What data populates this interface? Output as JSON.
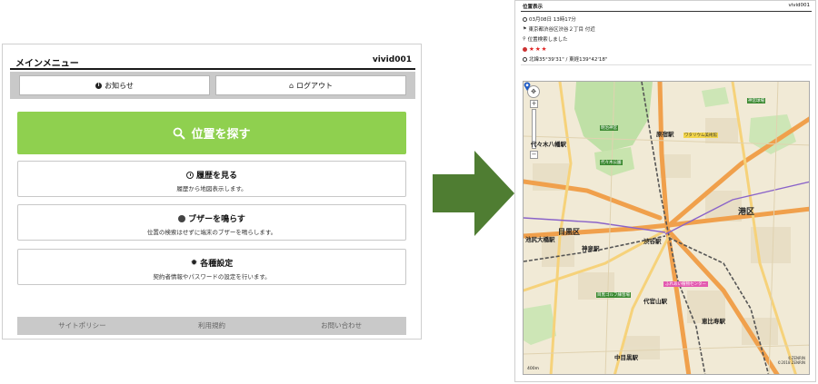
{
  "left": {
    "header": {
      "title": "メインメニュー",
      "user": "vivid001"
    },
    "nav": {
      "info_label": "お知らせ",
      "logout_label": "ログアウト"
    },
    "search_label": "位置を探す",
    "menu": [
      {
        "title": "履歴を見る",
        "desc": "履歴から地図表示します。"
      },
      {
        "title": "ブザーを鳴らす",
        "desc": "位置の検索はせずに端末のブザーを鳴らします。"
      },
      {
        "title": "各種設定",
        "desc": "契約者情報やパスワードの設定を行います。"
      }
    ],
    "footer": [
      "サイトポリシー",
      "利用規約",
      "お問い合わせ"
    ]
  },
  "right": {
    "header": {
      "title": "位置表示",
      "user": "vivid001"
    },
    "info": {
      "datetime": "03月08日 13時17分",
      "address": "東京都渋谷区渋谷２丁目 付近",
      "status": "位置検索しました",
      "accuracy_stars": "★★★",
      "coords": "北緯35°39'31\" / 東経139°42'18\""
    },
    "map": {
      "labels": {
        "yoyogi_hachiman": "代々木八幡駅",
        "harajuku": "原宿駅",
        "shibuya": "渋谷駅",
        "shinsen": "神泉駅",
        "daikanyama": "代官山駅",
        "ebisu": "恵比寿駅",
        "naka_meguro": "中目黒駅",
        "ikejiri": "池尻大橋駅",
        "meguro_ku": "目黒区",
        "minato_ku": "港区",
        "jingu": "明治神宮",
        "yoyogi_park": "代々木公園",
        "aoyama": "ワタリウム美術館",
        "kodomo": "ふれあい植物センター",
        "jingu_gaien": "神宮球場",
        "meguro_golf": "目黒ゴルフ練習場"
      },
      "scale": "400m",
      "copyright_1": "©ZENRIN",
      "copyright_2": "©2018 ZENRIN"
    }
  }
}
